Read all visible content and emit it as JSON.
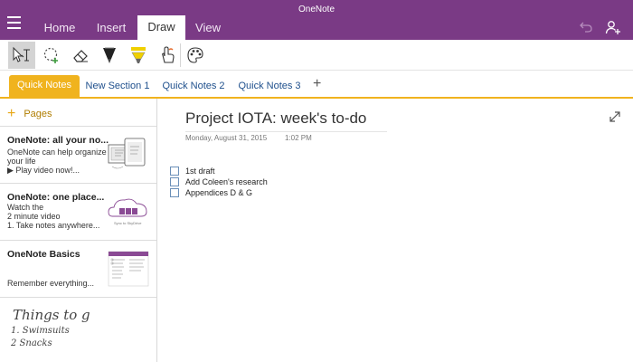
{
  "app": {
    "title": "OneNote"
  },
  "ribbon": {
    "tabs": [
      {
        "label": "Home"
      },
      {
        "label": "Insert"
      },
      {
        "label": "Draw"
      },
      {
        "label": "View"
      }
    ],
    "active_tab": "Draw",
    "icons": {
      "menu": "hamburger-menu-icon",
      "undo": "undo-icon",
      "share": "share-person-icon"
    }
  },
  "toolbar": {
    "tools": [
      {
        "name": "type-select-tool",
        "icon": "text-cursor-select-icon",
        "selected": true
      },
      {
        "name": "lasso-select-tool",
        "icon": "lasso-icon"
      },
      {
        "name": "eraser-tool",
        "icon": "eraser-icon"
      },
      {
        "name": "black-pen-tool",
        "icon": "black-pen-icon",
        "color": "#111111"
      },
      {
        "name": "yellow-highlighter-tool",
        "icon": "highlighter-icon",
        "color": "#f0d000"
      },
      {
        "name": "touch-drawing-tool",
        "icon": "hand-draw-icon"
      },
      {
        "name": "color-palette-tool",
        "icon": "palette-icon"
      }
    ]
  },
  "sections": {
    "tabs": [
      {
        "label": "Quick Notes"
      },
      {
        "label": "New Section 1"
      },
      {
        "label": "Quick Notes 2"
      },
      {
        "label": "Quick Notes 3"
      }
    ],
    "active": "Quick Notes",
    "add_label": "+"
  },
  "pages_pane": {
    "add_plus": "+",
    "add_label": "Pages",
    "pages": [
      {
        "title": "OneNote: all your no...",
        "lines": [
          "OneNote can help organize",
          "your life",
          "▶ Play video now!..."
        ]
      },
      {
        "title": "OneNote: one place...",
        "lines": [
          "Watch the",
          "2 minute video",
          "1. Take notes anywhere..."
        ],
        "thumb_caption": "Sync to SkyDrive"
      },
      {
        "title": "OneNote Basics",
        "lines": [
          "Remember everything..."
        ]
      },
      {
        "title": "",
        "lines": [],
        "handwriting": [
          "Things to g",
          "1. Swimsuits",
          "2 Snacks"
        ]
      }
    ]
  },
  "page": {
    "title": "Project IOTA: week's to-do",
    "date": "Monday, August 31, 2015",
    "time": "1:02 PM",
    "todos": [
      {
        "text": "1st draft",
        "checked": false
      },
      {
        "text": "Add Coleen's research",
        "checked": false
      },
      {
        "text": "Appendices D & G",
        "checked": false
      }
    ]
  },
  "colors": {
    "title_bar": "#7a3a85",
    "section_accent": "#f0b31e",
    "section_link": "#1e4f8c",
    "checkbox_border": "#6a8fb8"
  }
}
